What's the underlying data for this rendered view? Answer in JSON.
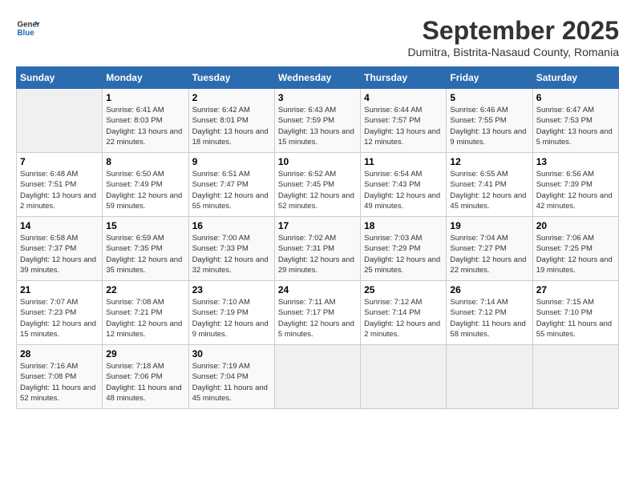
{
  "header": {
    "logo_line1": "General",
    "logo_line2": "Blue",
    "month_year": "September 2025",
    "location": "Dumitra, Bistrita-Nasaud County, Romania"
  },
  "days_of_week": [
    "Sunday",
    "Monday",
    "Tuesday",
    "Wednesday",
    "Thursday",
    "Friday",
    "Saturday"
  ],
  "weeks": [
    [
      {
        "num": "",
        "empty": true
      },
      {
        "num": "1",
        "rise": "6:41 AM",
        "set": "8:03 PM",
        "daylight": "13 hours and 22 minutes."
      },
      {
        "num": "2",
        "rise": "6:42 AM",
        "set": "8:01 PM",
        "daylight": "13 hours and 18 minutes."
      },
      {
        "num": "3",
        "rise": "6:43 AM",
        "set": "7:59 PM",
        "daylight": "13 hours and 15 minutes."
      },
      {
        "num": "4",
        "rise": "6:44 AM",
        "set": "7:57 PM",
        "daylight": "13 hours and 12 minutes."
      },
      {
        "num": "5",
        "rise": "6:46 AM",
        "set": "7:55 PM",
        "daylight": "13 hours and 9 minutes."
      },
      {
        "num": "6",
        "rise": "6:47 AM",
        "set": "7:53 PM",
        "daylight": "13 hours and 5 minutes."
      }
    ],
    [
      {
        "num": "7",
        "rise": "6:48 AM",
        "set": "7:51 PM",
        "daylight": "13 hours and 2 minutes."
      },
      {
        "num": "8",
        "rise": "6:50 AM",
        "set": "7:49 PM",
        "daylight": "12 hours and 59 minutes."
      },
      {
        "num": "9",
        "rise": "6:51 AM",
        "set": "7:47 PM",
        "daylight": "12 hours and 55 minutes."
      },
      {
        "num": "10",
        "rise": "6:52 AM",
        "set": "7:45 PM",
        "daylight": "12 hours and 52 minutes."
      },
      {
        "num": "11",
        "rise": "6:54 AM",
        "set": "7:43 PM",
        "daylight": "12 hours and 49 minutes."
      },
      {
        "num": "12",
        "rise": "6:55 AM",
        "set": "7:41 PM",
        "daylight": "12 hours and 45 minutes."
      },
      {
        "num": "13",
        "rise": "6:56 AM",
        "set": "7:39 PM",
        "daylight": "12 hours and 42 minutes."
      }
    ],
    [
      {
        "num": "14",
        "rise": "6:58 AM",
        "set": "7:37 PM",
        "daylight": "12 hours and 39 minutes."
      },
      {
        "num": "15",
        "rise": "6:59 AM",
        "set": "7:35 PM",
        "daylight": "12 hours and 35 minutes."
      },
      {
        "num": "16",
        "rise": "7:00 AM",
        "set": "7:33 PM",
        "daylight": "12 hours and 32 minutes."
      },
      {
        "num": "17",
        "rise": "7:02 AM",
        "set": "7:31 PM",
        "daylight": "12 hours and 29 minutes."
      },
      {
        "num": "18",
        "rise": "7:03 AM",
        "set": "7:29 PM",
        "daylight": "12 hours and 25 minutes."
      },
      {
        "num": "19",
        "rise": "7:04 AM",
        "set": "7:27 PM",
        "daylight": "12 hours and 22 minutes."
      },
      {
        "num": "20",
        "rise": "7:06 AM",
        "set": "7:25 PM",
        "daylight": "12 hours and 19 minutes."
      }
    ],
    [
      {
        "num": "21",
        "rise": "7:07 AM",
        "set": "7:23 PM",
        "daylight": "12 hours and 15 minutes."
      },
      {
        "num": "22",
        "rise": "7:08 AM",
        "set": "7:21 PM",
        "daylight": "12 hours and 12 minutes."
      },
      {
        "num": "23",
        "rise": "7:10 AM",
        "set": "7:19 PM",
        "daylight": "12 hours and 9 minutes."
      },
      {
        "num": "24",
        "rise": "7:11 AM",
        "set": "7:17 PM",
        "daylight": "12 hours and 5 minutes."
      },
      {
        "num": "25",
        "rise": "7:12 AM",
        "set": "7:14 PM",
        "daylight": "12 hours and 2 minutes."
      },
      {
        "num": "26",
        "rise": "7:14 AM",
        "set": "7:12 PM",
        "daylight": "11 hours and 58 minutes."
      },
      {
        "num": "27",
        "rise": "7:15 AM",
        "set": "7:10 PM",
        "daylight": "11 hours and 55 minutes."
      }
    ],
    [
      {
        "num": "28",
        "rise": "7:16 AM",
        "set": "7:08 PM",
        "daylight": "11 hours and 52 minutes."
      },
      {
        "num": "29",
        "rise": "7:18 AM",
        "set": "7:06 PM",
        "daylight": "11 hours and 48 minutes."
      },
      {
        "num": "30",
        "rise": "7:19 AM",
        "set": "7:04 PM",
        "daylight": "11 hours and 45 minutes."
      },
      {
        "num": "",
        "empty": true
      },
      {
        "num": "",
        "empty": true
      },
      {
        "num": "",
        "empty": true
      },
      {
        "num": "",
        "empty": true
      }
    ]
  ]
}
